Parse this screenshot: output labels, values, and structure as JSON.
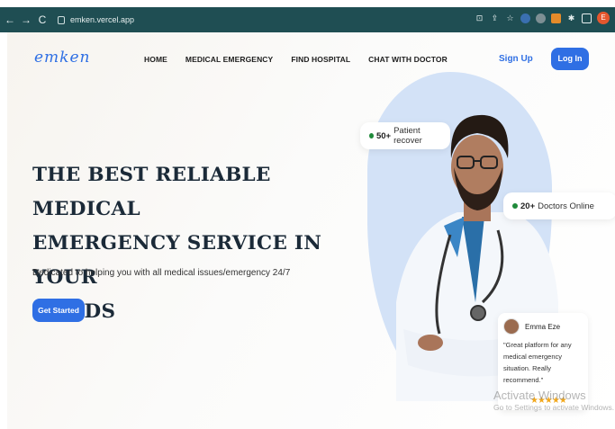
{
  "browser": {
    "url": "emken.vercel.app",
    "back_icon": "back-arrow-icon",
    "forward_icon": "forward-arrow-icon",
    "reload_icon": "reload-icon",
    "profile_initial": "E"
  },
  "nav": {
    "logo": "emken",
    "items": [
      "HOME",
      "MEDICAL EMERGENCY",
      "FIND HOSPITAL",
      "CHAT WITH DOCTOR"
    ],
    "signup": "Sign Up",
    "login": "Log In"
  },
  "hero": {
    "title_lines": [
      "THE BEST RELIABLE MEDICAL",
      "EMERGENCY SERVICE IN YOUR",
      "HANDS"
    ],
    "subtitle": "Dedicated to helping you with all medical issues/emergency 24/7",
    "cta": "Get Started"
  },
  "badges": {
    "patients_count": "50+",
    "patients_text": "Patient recover",
    "doctors_count": "20+",
    "doctors_text": "Doctors Online"
  },
  "review": {
    "name": "Emma Eze",
    "quote": "\"Great platform for any medical emergency situation. Really recommend.\"",
    "stars": "★★★★★"
  },
  "watermark": {
    "line1": "Activate Windows",
    "line2": "Go to Settings to activate Windows."
  },
  "colors": {
    "brand": "#2f6fe4",
    "chrome": "#1f4e53",
    "star": "#f2a81d",
    "online_dot": "#1f8a3a"
  }
}
